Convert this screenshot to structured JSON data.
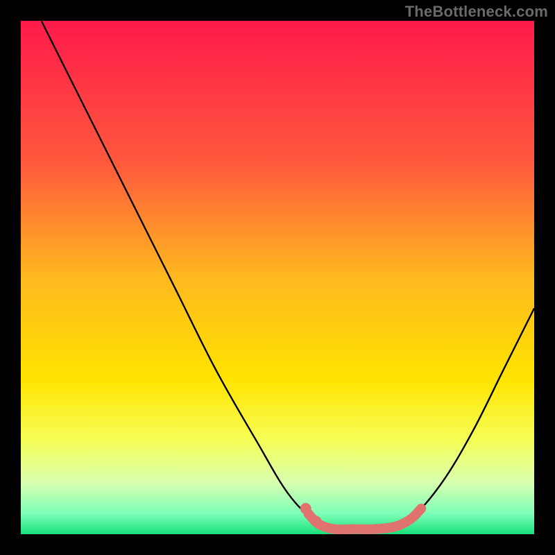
{
  "watermark": "TheBottleneck.com",
  "chart_data": {
    "type": "line",
    "title": "",
    "xlabel": "",
    "ylabel": "",
    "xlim": [
      0,
      100
    ],
    "ylim": [
      0,
      100
    ],
    "background_gradient": {
      "stops": [
        {
          "offset": 0,
          "color": "#ff1a4b"
        },
        {
          "offset": 28,
          "color": "#ff5a3c"
        },
        {
          "offset": 50,
          "color": "#ffb91e"
        },
        {
          "offset": 70,
          "color": "#ffe400"
        },
        {
          "offset": 82,
          "color": "#f5ff5a"
        },
        {
          "offset": 90,
          "color": "#d8ffb0"
        },
        {
          "offset": 96,
          "color": "#7dffb8"
        },
        {
          "offset": 100,
          "color": "#18e07a"
        }
      ]
    },
    "series": [
      {
        "name": "bottleneck-curve",
        "color": "#000000",
        "points": [
          {
            "x": 4,
            "y": 100
          },
          {
            "x": 8,
            "y": 92
          },
          {
            "x": 14,
            "y": 80
          },
          {
            "x": 22,
            "y": 64
          },
          {
            "x": 30,
            "y": 48
          },
          {
            "x": 38,
            "y": 32
          },
          {
            "x": 46,
            "y": 18
          },
          {
            "x": 52,
            "y": 8
          },
          {
            "x": 57,
            "y": 3
          },
          {
            "x": 62,
            "y": 1
          },
          {
            "x": 67,
            "y": 1
          },
          {
            "x": 72,
            "y": 1
          },
          {
            "x": 76,
            "y": 3
          },
          {
            "x": 82,
            "y": 10
          },
          {
            "x": 88,
            "y": 20
          },
          {
            "x": 94,
            "y": 32
          },
          {
            "x": 100,
            "y": 44
          }
        ]
      },
      {
        "name": "highlight-band",
        "color": "#e1736f",
        "points": [
          {
            "x": 56,
            "y": 4
          },
          {
            "x": 58,
            "y": 2
          },
          {
            "x": 61,
            "y": 1
          },
          {
            "x": 65,
            "y": 1
          },
          {
            "x": 69,
            "y": 1
          },
          {
            "x": 73,
            "y": 1.5
          },
          {
            "x": 76,
            "y": 3
          },
          {
            "x": 78,
            "y": 5
          }
        ]
      }
    ],
    "highlight_dots": {
      "color": "#e1736f",
      "points": [
        {
          "x": 55.5,
          "y": 5
        },
        {
          "x": 57.5,
          "y": 2.5
        }
      ]
    }
  }
}
